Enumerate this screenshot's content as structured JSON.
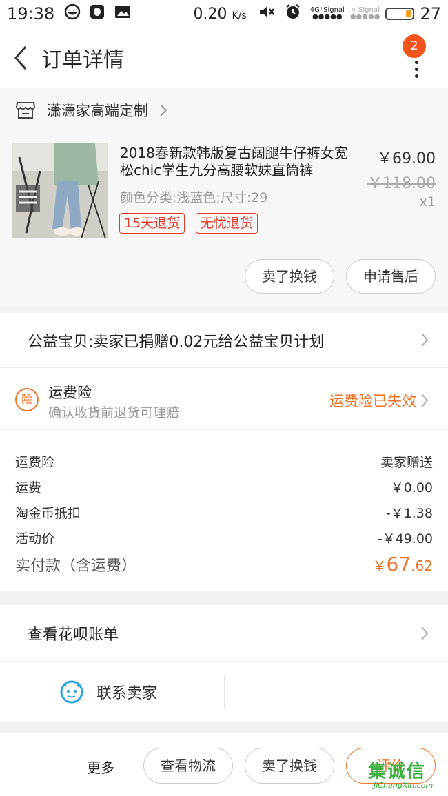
{
  "status_bar": {
    "time": "19:38",
    "speed": "0.20",
    "speed_unit": "K/s",
    "signal_label_1": "4G⁺Signal",
    "signal_label_2": "Signal",
    "battery": "27"
  },
  "header": {
    "title": "订单详情",
    "badge_count": "2"
  },
  "shop": {
    "name": "潇潇家高端定制"
  },
  "product": {
    "title": "2018春新款韩版复古阔腿牛仔裤女宽松chic学生九分高腰软妹直筒裤",
    "spec": "颜色分类:浅蓝色;尺寸:29",
    "price": "￥69.00",
    "original_price": "￥118.00",
    "quantity": "x1",
    "tags": [
      "15天退货",
      "无忧退货"
    ],
    "actions": [
      "卖了换钱",
      "申请售后"
    ]
  },
  "charity": {
    "text": "公益宝贝:卖家已捐赠0.02元给公益宝贝计划"
  },
  "insurance": {
    "icon_char": "险",
    "title": "运费险",
    "subtitle": "确认收货前退货可理赔",
    "status": "运费险已失效"
  },
  "fees": {
    "rows": [
      {
        "label": "运费险",
        "value": "卖家赠送"
      },
      {
        "label": "运费",
        "value": "￥0.00"
      },
      {
        "label": "淘金币抵扣",
        "value": "-￥1.38"
      },
      {
        "label": "活动价",
        "value": "-￥49.00"
      }
    ],
    "total_label": "实付款（含运费）",
    "total_currency": "￥",
    "total_int": "67",
    "total_dec": ".62"
  },
  "huabei": {
    "label": "查看花呗账单"
  },
  "contact": {
    "label": "联系卖家"
  },
  "bottom_bar": {
    "more": "更多",
    "logistics": "查看物流",
    "resell": "卖了换钱",
    "review": "评价"
  },
  "watermark": {
    "main": "集诚信",
    "sub": "JiChengXin.com"
  },
  "colors": {
    "accent": "#f07428",
    "badge": "#f5541c",
    "tag_red": "#e03a2a",
    "contact_icon": "#29a8e0"
  }
}
